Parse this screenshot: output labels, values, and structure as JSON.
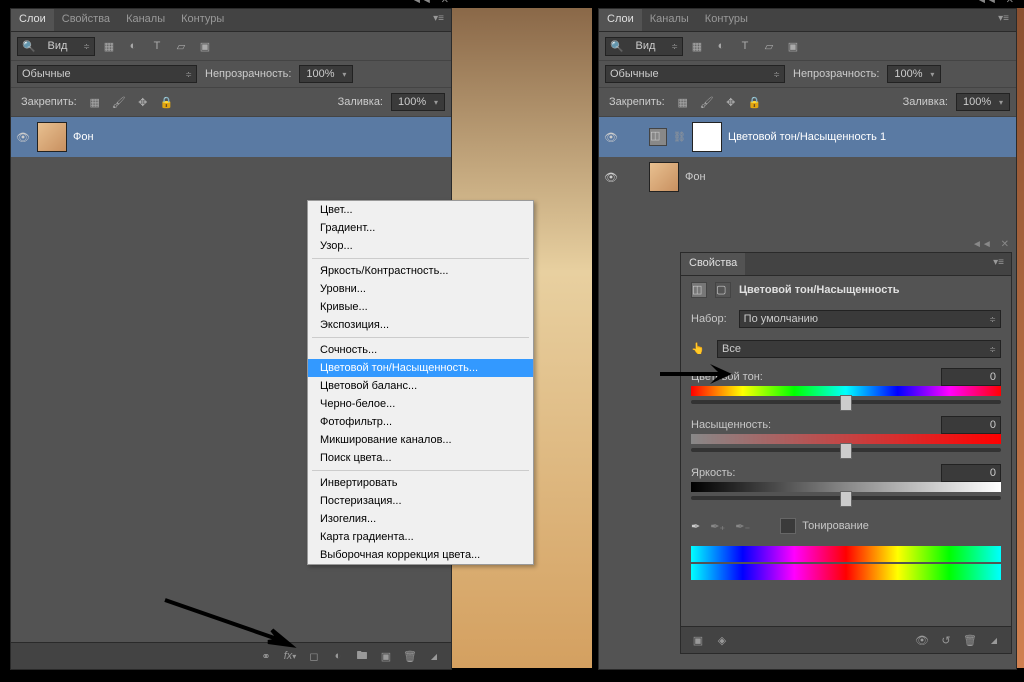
{
  "panels": {
    "left": {
      "tabs": [
        "Слои",
        "Свойства",
        "Каналы",
        "Контуры"
      ],
      "active_tab": "Слои",
      "filter_label": "Вид",
      "blend_mode": "Обычные",
      "opacity_label": "Непрозрачность:",
      "opacity_value": "100%",
      "lock_label": "Закрепить:",
      "fill_label": "Заливка:",
      "fill_value": "100%",
      "layers": [
        {
          "name": "Фон",
          "selected": true,
          "thumb": "face"
        }
      ]
    },
    "right": {
      "tabs": [
        "Слои",
        "Каналы",
        "Контуры"
      ],
      "active_tab": "Слои",
      "filter_label": "Вид",
      "blend_mode": "Обычные",
      "opacity_label": "Непрозрачность:",
      "opacity_value": "100%",
      "lock_label": "Закрепить:",
      "fill_label": "Заливка:",
      "fill_value": "100%",
      "layers": [
        {
          "name": "Цветовой тон/Насыщенность 1",
          "selected": true,
          "thumb": "adjustment"
        },
        {
          "name": "Фон",
          "selected": false,
          "thumb": "face"
        }
      ]
    }
  },
  "context_menu": {
    "groups": [
      [
        "Цвет...",
        "Градиент...",
        "Узор..."
      ],
      [
        "Яркость/Контрастность...",
        "Уровни...",
        "Кривые...",
        "Экспозиция..."
      ],
      [
        "Сочность...",
        "Цветовой тон/Насыщенность...",
        "Цветовой баланс...",
        "Черно-белое...",
        "Фотофильтр...",
        "Микширование каналов...",
        "Поиск цвета..."
      ],
      [
        "Инвертировать",
        "Постеризация...",
        "Изогелия...",
        "Карта градиента...",
        "Выборочная коррекция цвета..."
      ]
    ],
    "selected": "Цветовой тон/Насыщенность..."
  },
  "properties": {
    "tab": "Свойства",
    "title": "Цветовой тон/Насыщенность",
    "preset_label": "Набор:",
    "preset_value": "По умолчанию",
    "channel_value": "Все",
    "hue_label": "Цветовой тон:",
    "hue_value": "0",
    "sat_label": "Насыщенность:",
    "sat_value": "0",
    "light_label": "Яркость:",
    "light_value": "0",
    "colorize_label": "Тонирование"
  }
}
